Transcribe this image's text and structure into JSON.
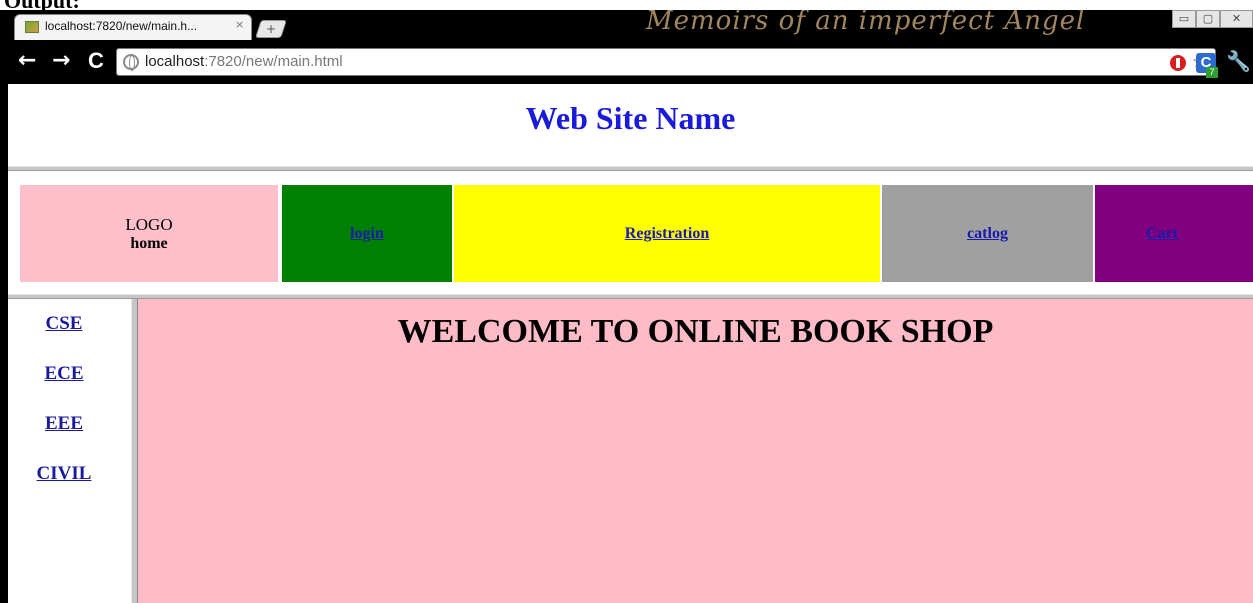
{
  "document": {
    "caption": "Output:"
  },
  "browser": {
    "tab_title": "localhost:7820/new/main.h...",
    "tab_close": "×",
    "new_tab": "+",
    "theme_text": "Memoirs of an imperfect Angel",
    "window_buttons": [
      "▭",
      "▢",
      "✕"
    ],
    "nav": {
      "back": "←",
      "forward": "→",
      "reload": "C"
    },
    "url_host": "localhost",
    "url_rest": ":7820/new/main.html",
    "star": "☆",
    "ext_c": "C",
    "ext_badge": "7",
    "wrench": "🔧"
  },
  "page": {
    "site_name": "Web Site Name",
    "logo_label": "LOGO",
    "home_label": "home",
    "nav_links": [
      "login",
      "Registration",
      "catlog",
      "Cart"
    ],
    "departments": [
      "CSE",
      "ECE",
      "EEE",
      "CIVIL"
    ],
    "welcome": "WELCOME TO ONLINE BOOK SHOP"
  },
  "colors": {
    "logo_cell": "#ffc0cb",
    "login_cell": "#008000",
    "registration_cell": "#ffff00",
    "catlog_cell": "#a0a0a0",
    "cart_cell": "#800080",
    "main_background": "#ffbcc8",
    "site_name": "#1a1adb"
  }
}
